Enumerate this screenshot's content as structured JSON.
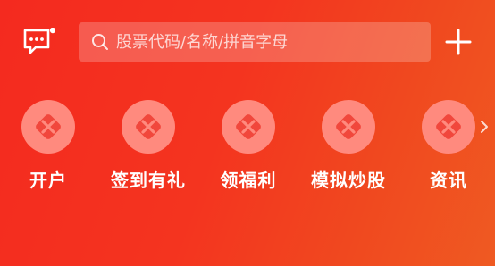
{
  "search": {
    "placeholder": "股票代码/名称/拼音字母"
  },
  "header": {
    "message_icon": "message-icon",
    "add_icon": "plus-icon",
    "notification_dot_color": "#ffffff"
  },
  "actions": [
    {
      "label": "开户",
      "icon": "placeholder-logo-icon"
    },
    {
      "label": "签到有礼",
      "icon": "placeholder-logo-icon"
    },
    {
      "label": "领福利",
      "icon": "placeholder-logo-icon"
    },
    {
      "label": "模拟炒股",
      "icon": "placeholder-logo-icon"
    },
    {
      "label": "资讯",
      "icon": "placeholder-logo-icon"
    }
  ],
  "colors": {
    "background_start": "#f42a1f",
    "background_end": "#ef5a22",
    "icon_circle": "#ff8a7e",
    "icon_mark": "#f1473c"
  }
}
